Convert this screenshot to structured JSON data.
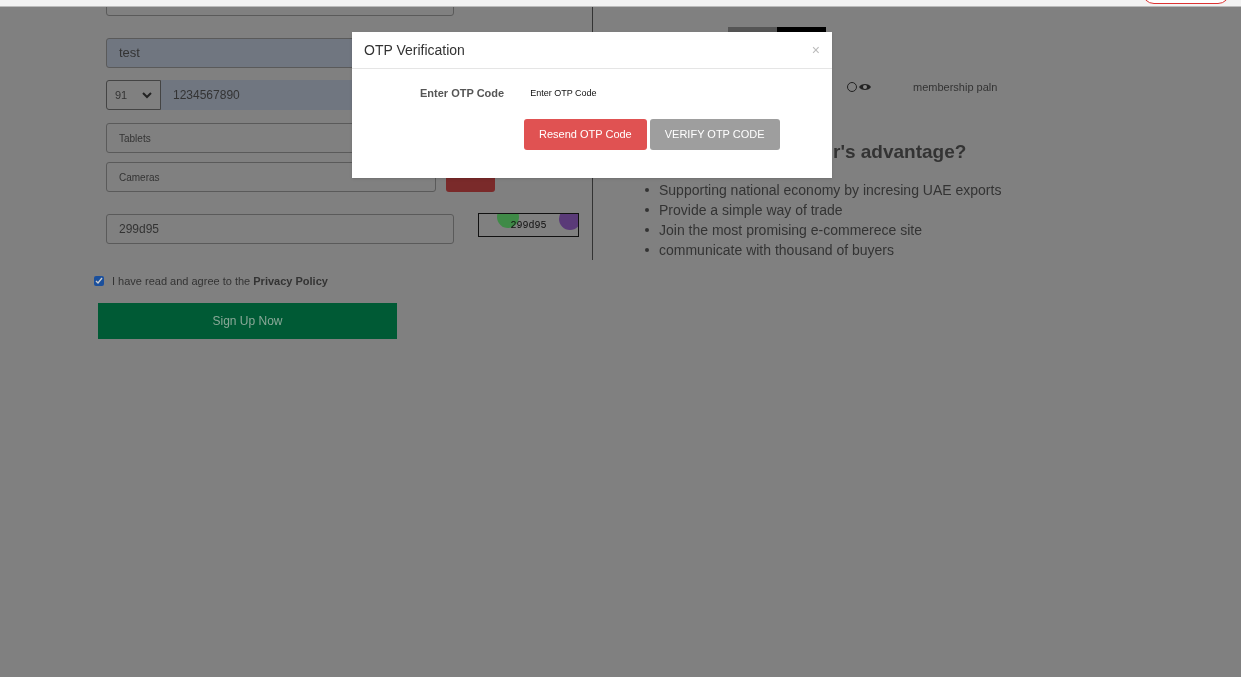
{
  "form": {
    "name_value": "test",
    "country_code": "91",
    "phone_value": "1234567890",
    "category_1": "Tablets",
    "category_2": "Cameras",
    "captcha_value": "299d95",
    "captcha_image_text": "299d95"
  },
  "agree": {
    "checked": true,
    "text": "I have read and agree to the **Privacy Policy**"
  },
  "signup_button": "Sign Up Now",
  "plan": {
    "selected": false,
    "label": "membership paln"
  },
  "advantage": {
    "heading": "r's advantage?",
    "items": [
      "Supporting national economy by incresing UAE exports",
      "Provide a simple way of trade",
      "Join the most promising e-commerece site",
      "communicate with thousand of buyers"
    ]
  },
  "modal": {
    "title": "OTP Verification",
    "close": "×",
    "field_label": "Enter OTP Code",
    "placeholder": "Enter OTP Code",
    "buttons": [
      {
        "kind": "danger",
        "label": "Resend OTP Code"
      },
      {
        "kind": "neutral",
        "label": "VERIFY OTP CODE"
      }
    ]
  }
}
